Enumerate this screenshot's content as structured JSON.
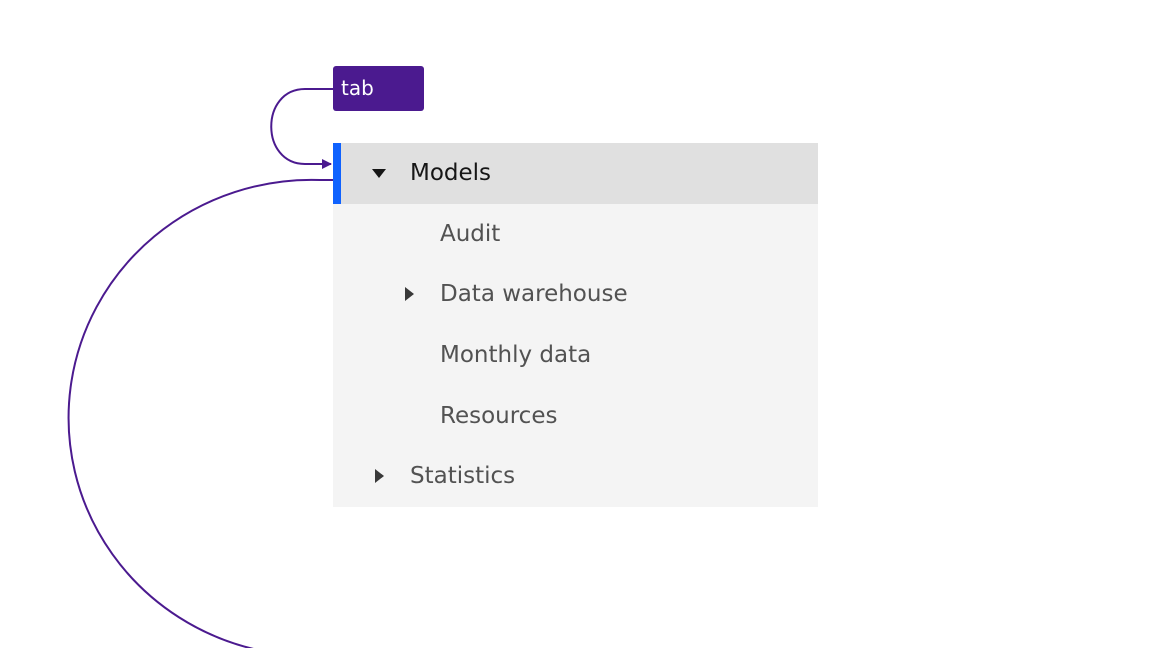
{
  "annotation": {
    "badge_label": "tab",
    "badge_color": "#4b1a8f",
    "connector_color": "#4b1a8f"
  },
  "tree": {
    "selection_color": "#0f62fe",
    "nodes": [
      {
        "label": "Models",
        "level": 1,
        "expander": "expanded",
        "selected": true
      },
      {
        "label": "Audit",
        "level": 2,
        "expander": "none",
        "selected": false
      },
      {
        "label": "Data warehouse",
        "level": 2,
        "expander": "collapsed",
        "selected": false
      },
      {
        "label": "Monthly data",
        "level": 2,
        "expander": "none",
        "selected": false
      },
      {
        "label": "Resources",
        "level": 2,
        "expander": "none",
        "selected": false
      },
      {
        "label": "Statistics",
        "level": 1,
        "expander": "collapsed",
        "selected": false
      }
    ]
  }
}
